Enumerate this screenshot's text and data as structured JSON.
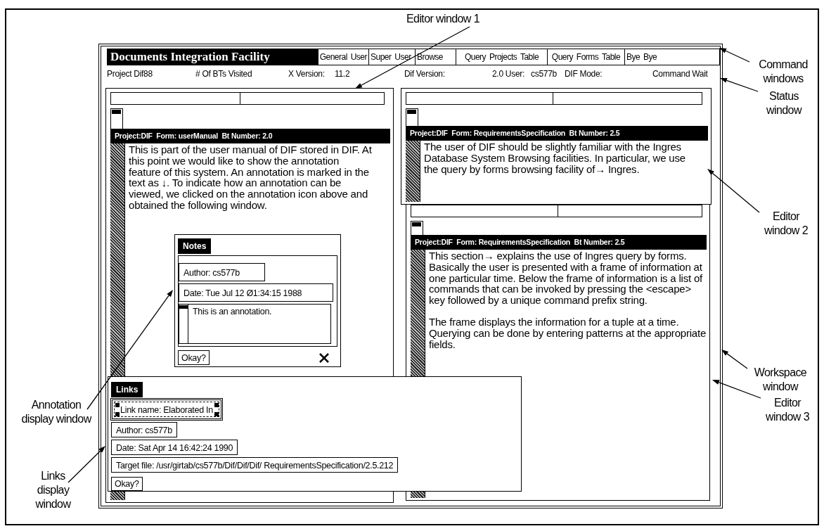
{
  "callouts": [
    {
      "text": "Editor window 1"
    },
    {
      "text": "Command windows"
    },
    {
      "text": "Status window"
    },
    {
      "text": "Editor window 2"
    },
    {
      "text": "Workspace window"
    },
    {
      "text": "Annotation display window"
    },
    {
      "text": "Editor window 3"
    },
    {
      "text": "Links display window"
    }
  ],
  "app": {
    "title": "Documents Integration Facility",
    "commands": [
      "General User",
      "Super User",
      "Browse",
      "Query Projects Table",
      "Query Forms Table",
      "Bye Bye"
    ],
    "status": [
      "Project Dif88",
      "# Of BTs Visited",
      "X Version:",
      "11.2",
      "Dif Version:",
      "2.0 User:",
      "cs577b",
      "DIF Mode:",
      "Command Wait"
    ]
  },
  "editors": [
    {
      "header": "Project:DIF  Form: userManual  Bt Number: 2.0",
      "paragraphs": [
        "This is part of the user manual of DIF stored in DIF. At this point we would like to show the annotation feature of this system. An annotation is marked in the text as ↓. To indicate how an annotation can be viewed, we clicked on the annotation icon above and obtained the following window."
      ]
    },
    {
      "header": "Project:DIF  Form: RequirementsSpecification  Bt Number: 2.5",
      "paragraphs": [
        "The user of DIF should be slightly familiar with the Ingres Database System Browsing facilities. In particular, we use the query by forms browsing facility of→ Ingres."
      ]
    },
    {
      "header": "Project:DIF  Form: RequirementsSpecification  Bt Number: 2.5",
      "paragraphs": [
        "This section→ explains the use of Ingres query by forms. Basically the user is presented with a frame of information at one particular time. Below the frame of information is a list of commands that can be invoked by pressing the <escape> key followed by a unique command prefix string.",
        "The frame displays the information for a tuple at a time. Querying can be done by entering patterns at the appropriate fields."
      ]
    }
  ],
  "notes": {
    "title": "Notes",
    "author": "Author: cs577b",
    "date": "Date: Tue Jul 12 Ø1:34:15 1988",
    "annotation": "This is an annotation.",
    "button": "Okay?"
  },
  "links": {
    "title": "Links",
    "fields": [
      {
        "text": "Link name: Elaborated In",
        "selected": true
      },
      {
        "text": "Author: cs577b",
        "selected": false
      },
      {
        "text": "Date: Sat Apr 14 16:42:24 1990",
        "selected": false
      },
      {
        "text": "Target file: /usr/girtab/cs577b/Dif/Dif/Dif/ RequirementsSpecification/2.5.212",
        "selected": false
      }
    ],
    "button": "Okay?"
  }
}
